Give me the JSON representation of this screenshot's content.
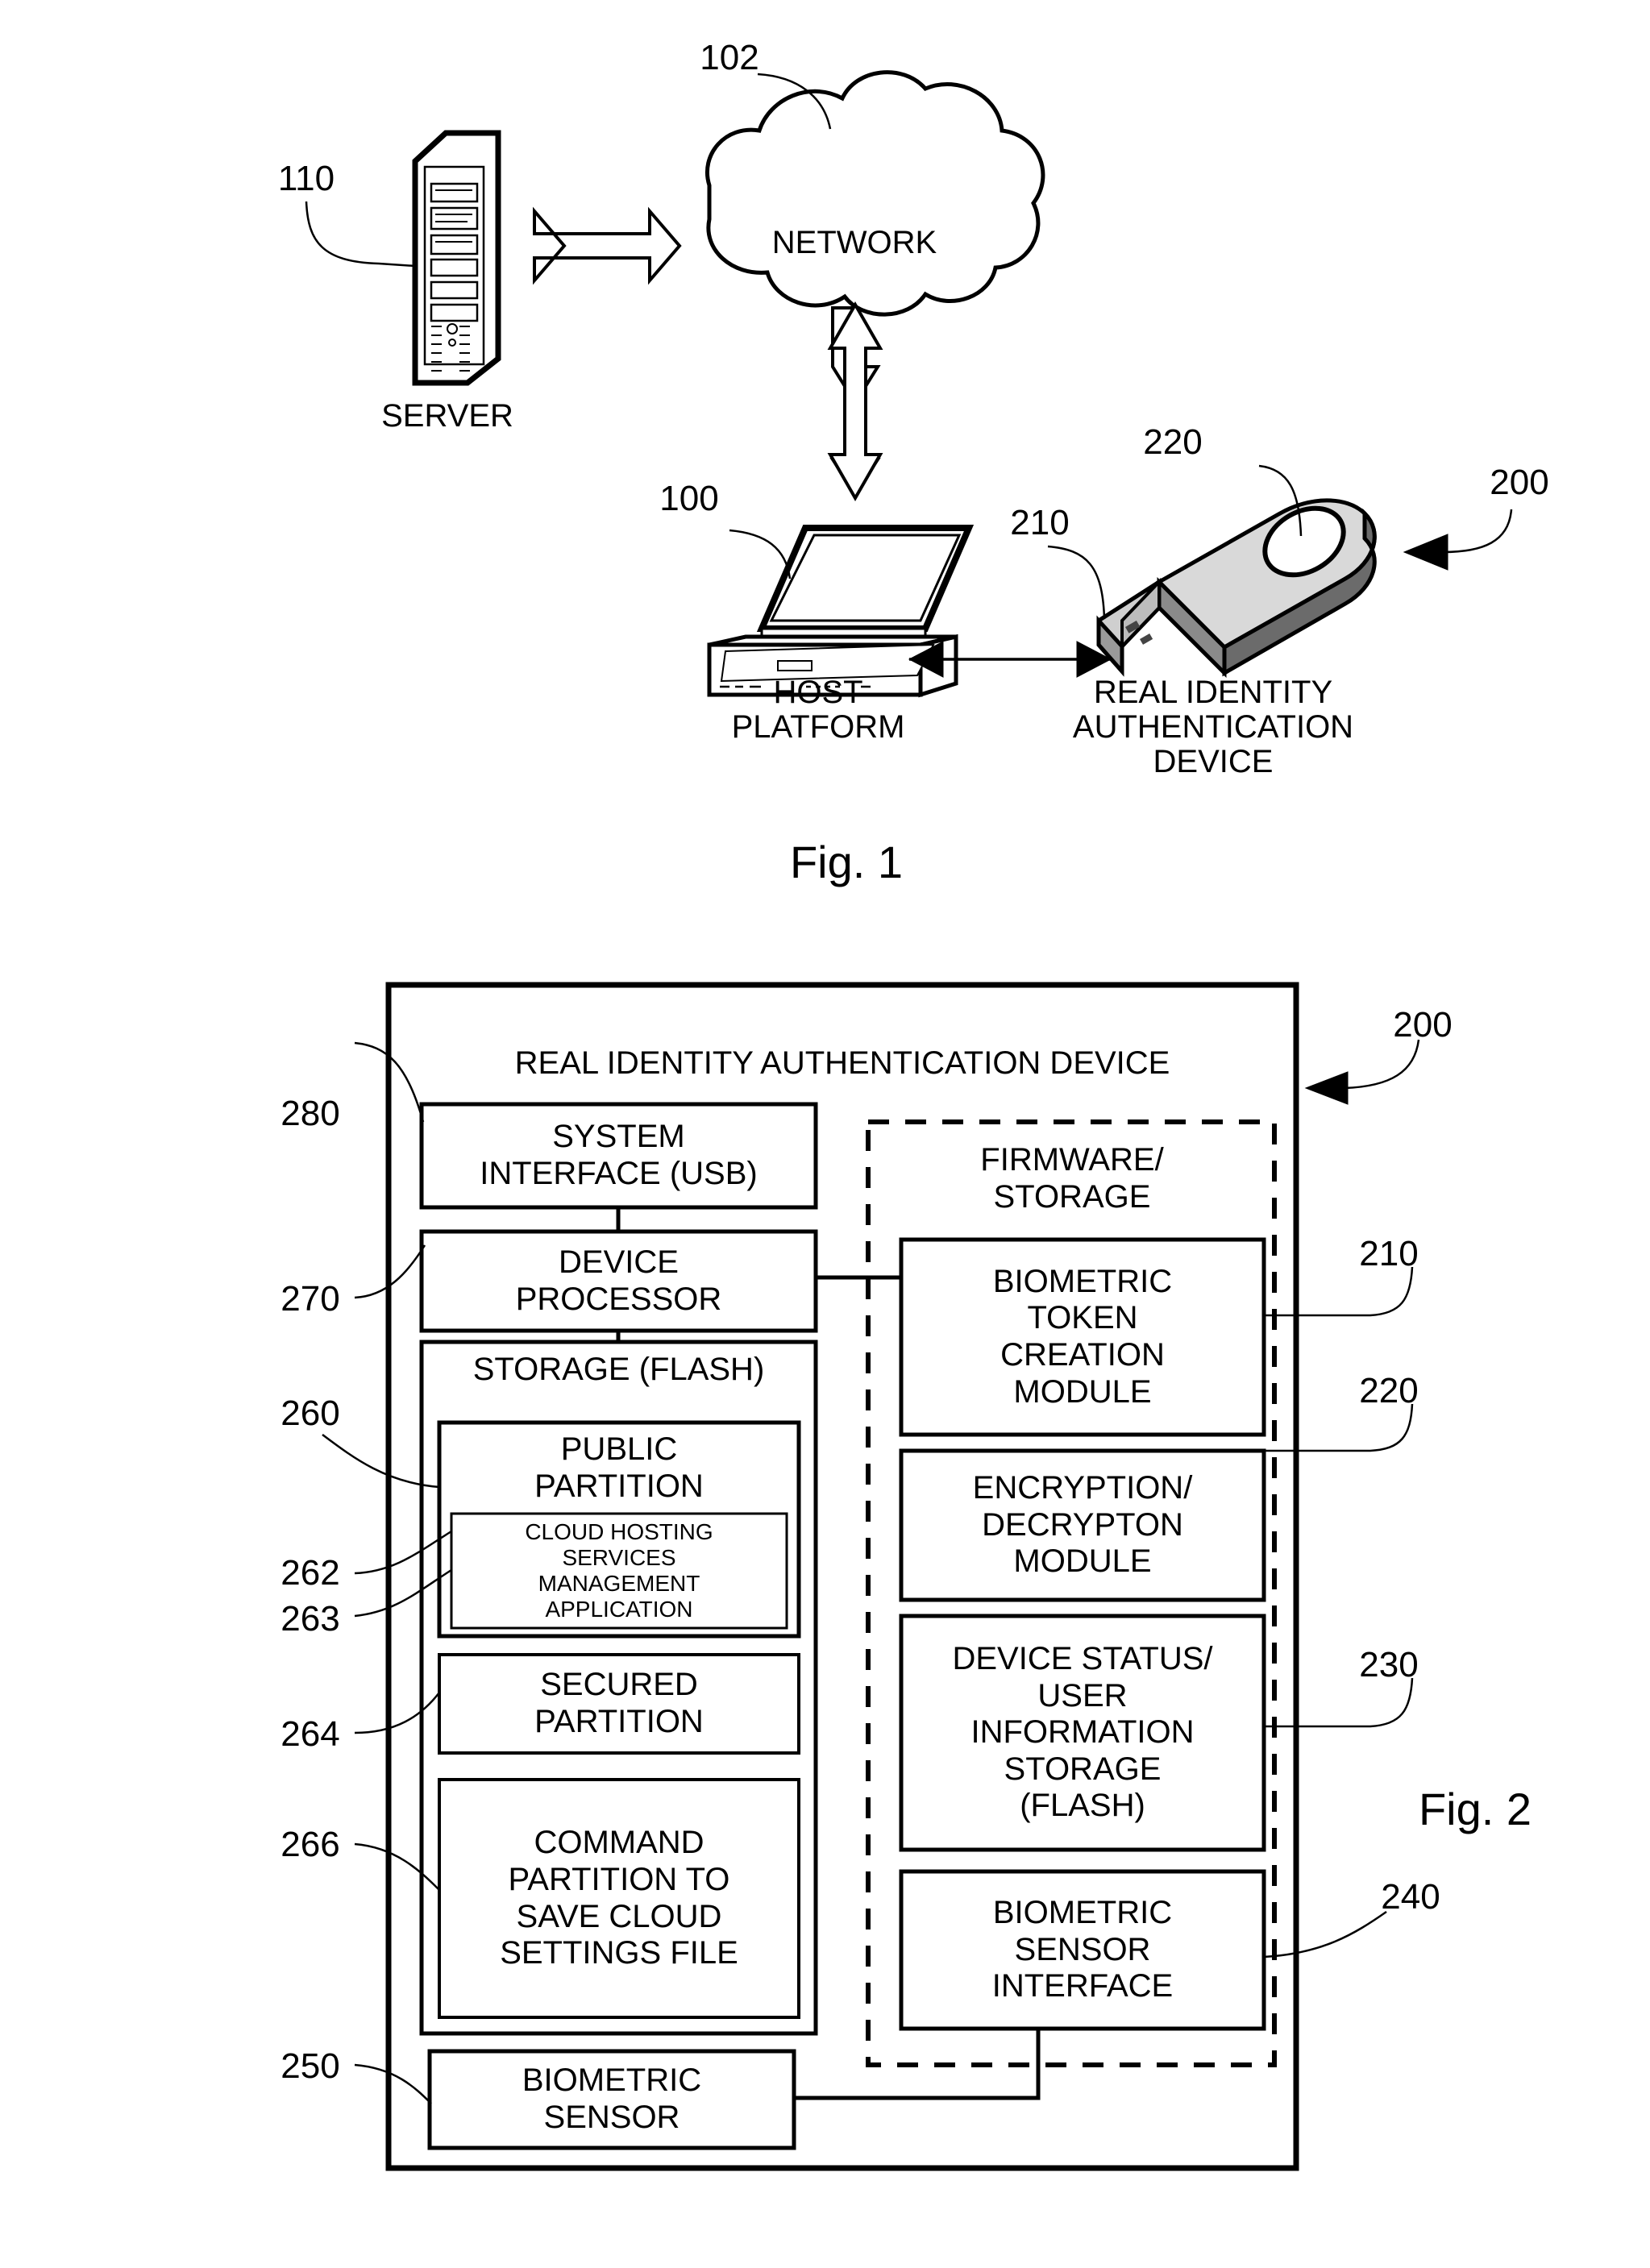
{
  "figure1": {
    "caption": "Fig. 1",
    "refs": {
      "network": "102",
      "server": "110",
      "host": "100",
      "usb_port": "210",
      "usb_button": "220",
      "device": "200"
    },
    "nodes": {
      "network_label": "NETWORK",
      "server_label": "SERVER",
      "host_label": "HOST\nPLATFORM",
      "device_label": "REAL IDENTITY\nAUTHENTICATION\nDEVICE"
    },
    "icons": {
      "server": "server-tower-icon",
      "cloud": "cloud-icon",
      "laptop": "laptop-icon",
      "usb": "usb-flash-drive-icon",
      "double_arrow_h": "double-headed-arrow-horizontal-icon",
      "double_arrow_v": "double-headed-arrow-vertical-icon",
      "arrow_right": "arrow-right-icon",
      "arrow_left": "arrow-left-icon"
    }
  },
  "figure2": {
    "caption": "Fig. 2",
    "device_title": "REAL IDENTITY AUTHENTICATION DEVICE",
    "device_ref": "200",
    "left_column": [
      {
        "ref": "280",
        "label": "SYSTEM\nINTERFACE (USB)"
      },
      {
        "ref": "270",
        "label": "DEVICE\nPROCESSOR"
      }
    ],
    "storage": {
      "title": "STORAGE (FLASH)",
      "public_partition": {
        "ref": "260",
        "label": "PUBLIC\nPARTITION",
        "inner": {
          "ref": "262",
          "ref_alt": "263",
          "label": "CLOUD HOSTING\nSERVICES\nMANAGEMENT\nAPPLICATION"
        }
      },
      "secured_partition": {
        "ref": "264",
        "label": "SECURED\nPARTITION"
      },
      "command_partition": {
        "ref": "266",
        "label": "COMMAND\nPARTITION TO\nSAVE CLOUD\nSETTINGS FILE"
      }
    },
    "biometric_sensor": {
      "ref": "250",
      "label": "BIOMETRIC\nSENSOR"
    },
    "firmware": {
      "title": "FIRMWARE/\nSTORAGE",
      "modules": [
        {
          "ref": "210",
          "label": "BIOMETRIC\nTOKEN\nCREATION\nMODULE"
        },
        {
          "ref": "220",
          "label": "ENCRYPTION/\nDECRYPTON\nMODULE"
        },
        {
          "ref": "230",
          "label": "DEVICE STATUS/\nUSER\nINFORMATION\nSTORAGE\n(FLASH)"
        },
        {
          "ref": "240",
          "label": "BIOMETRIC\nSENSOR\nINTERFACE"
        }
      ]
    }
  },
  "colors": {
    "ink": "#000000",
    "paper": "#ffffff"
  }
}
